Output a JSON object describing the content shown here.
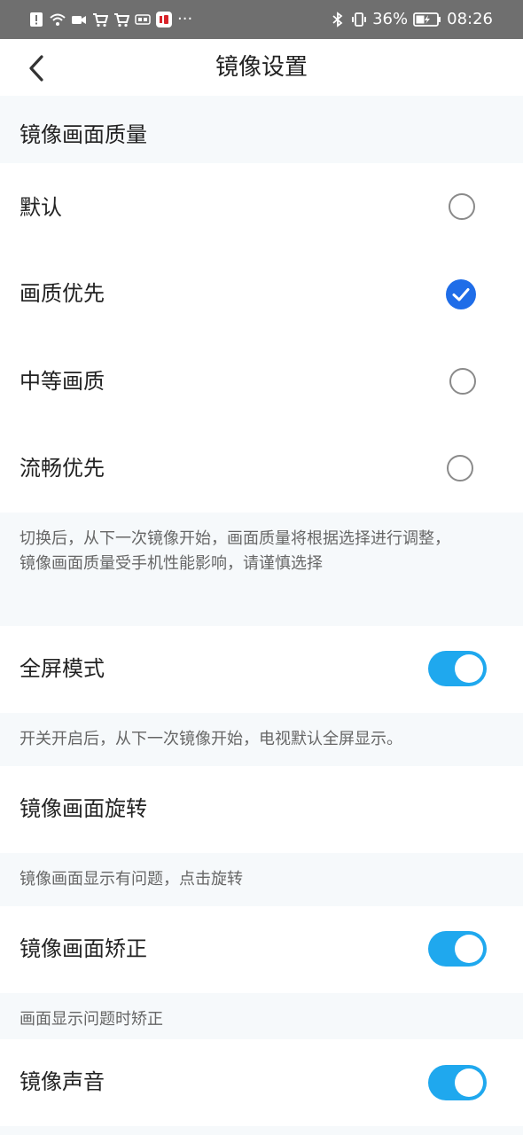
{
  "status_bar": {
    "battery_percent": "36%",
    "time": "08:26",
    "more_indicator": "···",
    "left_icons": [
      "alert-icon",
      "wifi-icon",
      "video-icon",
      "cart-icon",
      "cart-icon",
      "taobao-icon",
      "app-icon"
    ],
    "right_icons": [
      "bluetooth-icon",
      "vibrate-icon",
      "battery-icon"
    ]
  },
  "nav": {
    "title": "镜像设置",
    "back_icon": "chevron-left-icon"
  },
  "quality": {
    "section_title": "镜像画面质量",
    "options": [
      {
        "label": "默认",
        "selected": false
      },
      {
        "label": "画质优先",
        "selected": true
      },
      {
        "label": "中等画质",
        "selected": false
      },
      {
        "label": "流畅优先",
        "selected": false
      }
    ],
    "hint": "切换后，从下一次镜像开始，画面质量将根据选择进行调整，镜像画面质量受手机性能影响，请谨慎选择"
  },
  "fullscreen": {
    "label": "全屏模式",
    "on": true,
    "hint": "开关开启后，从下一次镜像开始，电视默认全屏显示。"
  },
  "rotate": {
    "label": "镜像画面旋转",
    "hint": "镜像画面显示有问题，点击旋转"
  },
  "correction": {
    "label": "镜像画面矫正",
    "on": true,
    "hint": "画面显示问题时矫正"
  },
  "sound": {
    "label": "镜像声音",
    "on": true
  },
  "colors": {
    "accent_blue": "#1f6de8",
    "toggle_on": "#1fa8ee",
    "section_bg": "#f6f9fb"
  }
}
